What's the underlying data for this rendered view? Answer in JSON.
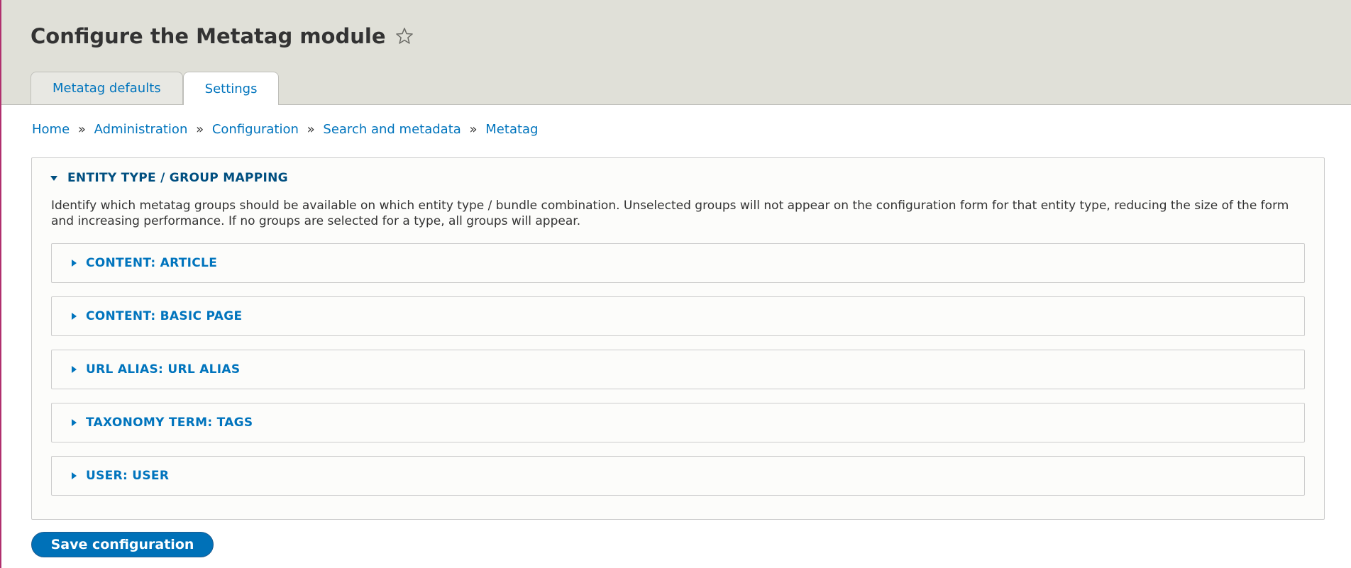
{
  "page": {
    "title": "Configure the Metatag module",
    "favorite_icon": "star-outline-icon"
  },
  "tabs": [
    {
      "label": "Metatag defaults",
      "active": false
    },
    {
      "label": "Settings",
      "active": true
    }
  ],
  "breadcrumb": {
    "separator": "»",
    "items": [
      "Home",
      "Administration",
      "Configuration",
      "Search and metadata",
      "Metatag"
    ]
  },
  "fieldset": {
    "legend": "ENTITY TYPE / GROUP MAPPING",
    "expanded": true,
    "description": "Identify which metatag groups should be available on which entity type / bundle combination. Unselected groups will not appear on the configuration form for that entity type, reducing the size of the form and increasing performance. If no groups are selected for a type, all groups will appear.",
    "groups": [
      {
        "label": "CONTENT: ARTICLE",
        "expanded": false
      },
      {
        "label": "CONTENT: BASIC PAGE",
        "expanded": false
      },
      {
        "label": "URL ALIAS: URL ALIAS",
        "expanded": false
      },
      {
        "label": "TAXONOMY TERM: TAGS",
        "expanded": false
      },
      {
        "label": "USER: USER",
        "expanded": false
      }
    ]
  },
  "actions": {
    "save_label": "Save configuration"
  },
  "colors": {
    "link": "#0074bd",
    "legend": "#004f80",
    "header_bg": "#e0e0d8",
    "button_bg": "#0071b8"
  }
}
